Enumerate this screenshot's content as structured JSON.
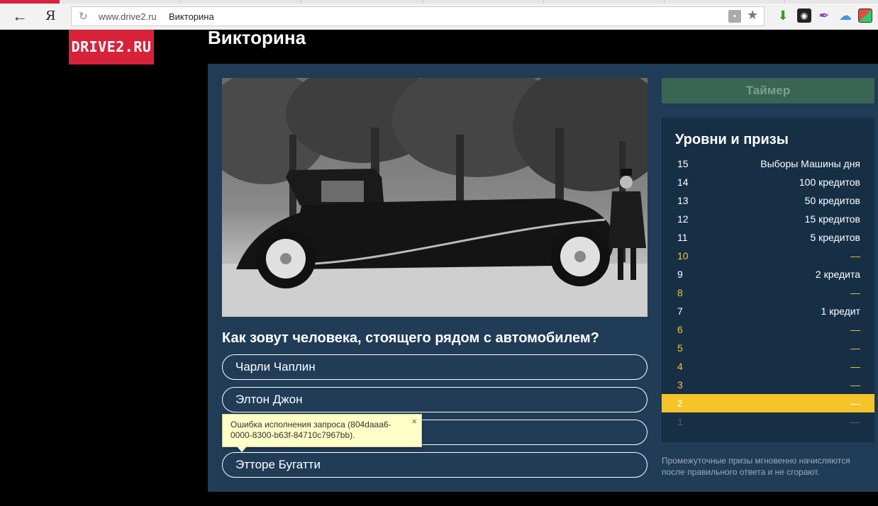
{
  "browser": {
    "back_icon": "arrow-left-icon",
    "yandex_logo": "Я",
    "url_host": "www.drive2.ru",
    "url_title": "Викторина"
  },
  "site": {
    "logo": "DRIVE2.RU",
    "page_title": "Викторина"
  },
  "quiz": {
    "question": "Как зовут человека, стоящего рядом с автомобилем?",
    "answers": [
      "Чарли Чаплин",
      "Элтон Джон",
      "",
      "Этторе Бугатти"
    ],
    "timer_label": "Таймер"
  },
  "levels": {
    "title": "Уровни и призы",
    "rows": [
      {
        "num": "15",
        "prize": "Выборы Машины дня"
      },
      {
        "num": "14",
        "prize": "100 кредитов"
      },
      {
        "num": "13",
        "prize": "50 кредитов"
      },
      {
        "num": "12",
        "prize": "15 кредитов"
      },
      {
        "num": "11",
        "prize": "5 кредитов"
      },
      {
        "num": "10",
        "prize": "—"
      },
      {
        "num": "9",
        "prize": "2 кредита"
      },
      {
        "num": "8",
        "prize": "—"
      },
      {
        "num": "7",
        "prize": "1 кредит"
      },
      {
        "num": "6",
        "prize": "—"
      },
      {
        "num": "5",
        "prize": "—"
      },
      {
        "num": "4",
        "prize": "—"
      },
      {
        "num": "3",
        "prize": "—"
      },
      {
        "num": "2",
        "prize": "—"
      },
      {
        "num": "1",
        "prize": "—"
      }
    ],
    "current_level": "2",
    "footnote": "Промежуточные призы мгновенно начисляются после правильного ответа и не сгорают."
  },
  "error_tooltip": {
    "text": "Ошибка исполнения запроса (804daaa6-0000-8300-b63f-84710c7967bb).",
    "close": "×"
  },
  "colors": {
    "brand_red": "#d8223a",
    "panel_bg": "#203c57",
    "levels_bg": "#172f45",
    "gold": "#f4c429",
    "timer_bg": "#3a6552"
  }
}
